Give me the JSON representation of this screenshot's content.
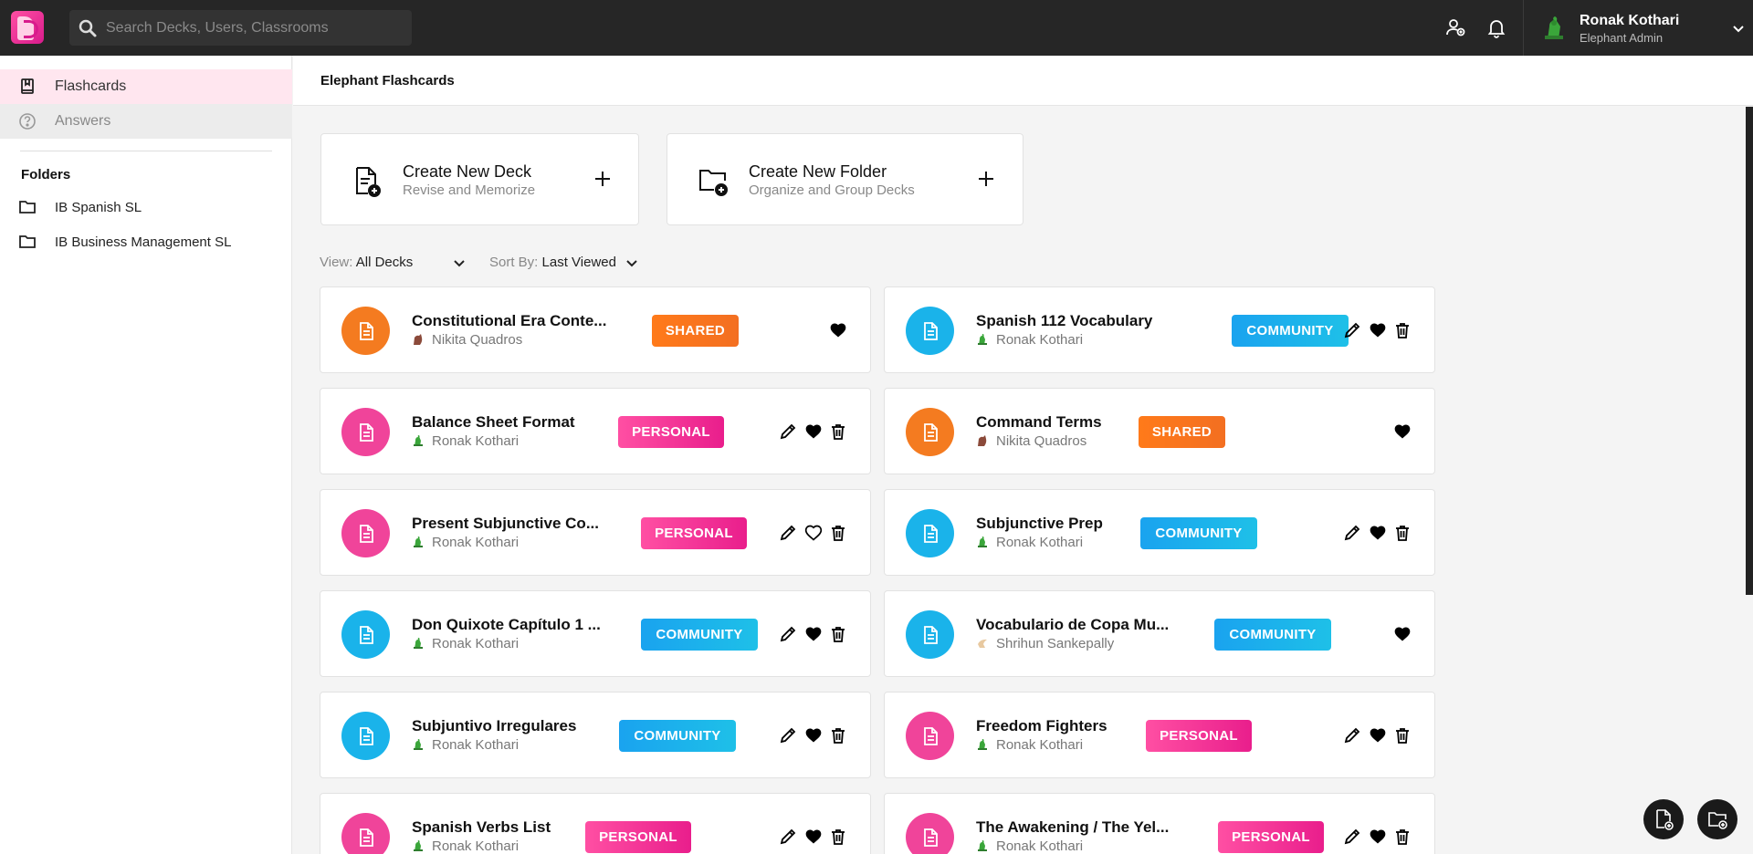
{
  "search": {
    "placeholder": "Search Decks, Users, Classrooms"
  },
  "user": {
    "name": "Ronak Kothari",
    "role": "Elephant Admin"
  },
  "sidebar": {
    "nav": [
      {
        "label": "Flashcards",
        "icon": "book-icon",
        "active": true
      },
      {
        "label": "Answers",
        "icon": "help-circle-icon",
        "active": false
      }
    ],
    "folders_title": "Folders",
    "folders": [
      {
        "label": "IB Spanish SL"
      },
      {
        "label": "IB Business Management SL"
      }
    ]
  },
  "main": {
    "title": "Elephant Flashcards",
    "create_deck": {
      "title": "Create New Deck",
      "subtitle": "Revise and Memorize"
    },
    "create_folder": {
      "title": "Create New Folder",
      "subtitle": "Organize and Group Decks"
    },
    "view": {
      "label": "View:",
      "value": "All Decks"
    },
    "sort": {
      "label": "Sort By:",
      "value": "Last Viewed"
    }
  },
  "decks": [
    {
      "title": "Constitutional Era Conte...",
      "owner": "Nikita Quadros",
      "badge": "SHARED",
      "icon_color": "orange",
      "liked": true,
      "editable": false
    },
    {
      "title": "Spanish 112 Vocabulary",
      "owner": "Ronak Kothari",
      "badge": "COMMUNITY",
      "icon_color": "blue",
      "liked": true,
      "editable": true
    },
    {
      "title": "Balance Sheet Format",
      "owner": "Ronak Kothari",
      "badge": "PERSONAL",
      "icon_color": "pink",
      "liked": true,
      "editable": true
    },
    {
      "title": "Command Terms",
      "owner": "Nikita Quadros",
      "badge": "SHARED",
      "icon_color": "orange",
      "liked": true,
      "editable": false
    },
    {
      "title": "Present Subjunctive Co...",
      "owner": "Ronak Kothari",
      "badge": "PERSONAL",
      "icon_color": "pink",
      "liked": false,
      "editable": true
    },
    {
      "title": "Subjunctive Prep",
      "owner": "Ronak Kothari",
      "badge": "COMMUNITY",
      "icon_color": "blue",
      "liked": true,
      "editable": true
    },
    {
      "title": "Don Quixote Capítulo 1 ...",
      "owner": "Ronak Kothari",
      "badge": "COMMUNITY",
      "icon_color": "blue",
      "liked": true,
      "editable": true
    },
    {
      "title": "Vocabulario de Copa Mu...",
      "owner": "Shrihun Sankepally",
      "badge": "COMMUNITY",
      "icon_color": "blue",
      "liked": true,
      "editable": false
    },
    {
      "title": "Subjuntivo Irregulares",
      "owner": "Ronak Kothari",
      "badge": "COMMUNITY",
      "icon_color": "blue",
      "liked": true,
      "editable": true
    },
    {
      "title": "Freedom Fighters",
      "owner": "Ronak Kothari",
      "badge": "PERSONAL",
      "icon_color": "pink",
      "liked": true,
      "editable": true
    },
    {
      "title": "Spanish Verbs List",
      "owner": "Ronak Kothari",
      "badge": "PERSONAL",
      "icon_color": "pink",
      "liked": true,
      "editable": true
    },
    {
      "title": "The Awakening / The Yel...",
      "owner": "Ronak Kothari",
      "badge": "PERSONAL",
      "icon_color": "pink",
      "liked": true,
      "editable": true
    }
  ],
  "colors": {
    "orange": "#f47b20",
    "pink": "#f0449a",
    "blue": "#1ab3ea",
    "accent": "#e91e8c",
    "topbar": "#262626"
  }
}
